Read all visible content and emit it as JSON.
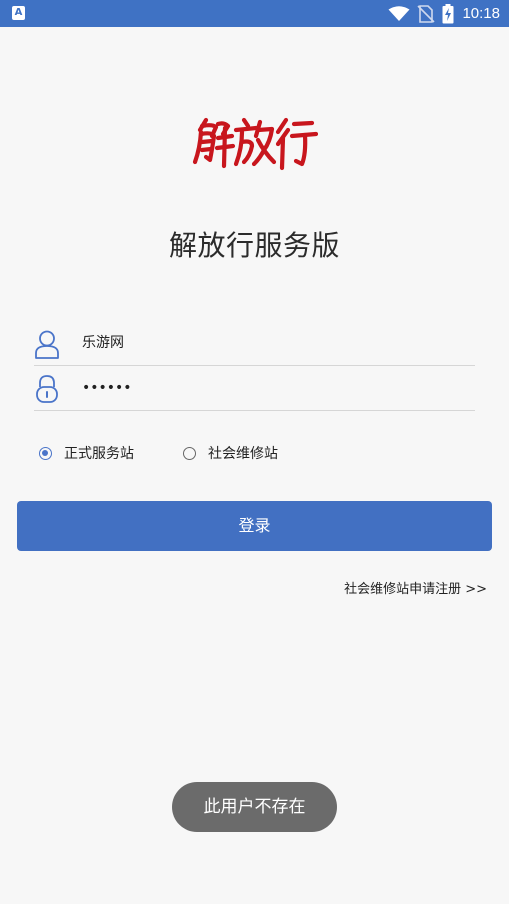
{
  "status_bar": {
    "left_icon": "A",
    "time": "10:18",
    "icons": [
      "wifi-icon",
      "no-sim-icon",
      "battery-charging-icon"
    ]
  },
  "app": {
    "logo_text": "解放行",
    "title": "解放行服务版"
  },
  "form": {
    "username": {
      "value": "乐游网",
      "icon": "user-icon"
    },
    "password": {
      "value": "••••••",
      "icon": "lock-icon"
    },
    "station_type": {
      "options": [
        {
          "label": "正式服务站",
          "checked": true
        },
        {
          "label": "社会维修站",
          "checked": false
        }
      ]
    },
    "login_button": "登录",
    "register_link": "社会维修站申请注册 >>"
  },
  "toast": {
    "message": "此用户不存在"
  },
  "colors": {
    "primary": "#4270c2",
    "status_bar": "#3f72c4",
    "logo_red": "#c8161d",
    "background": "#f7f7f7",
    "toast_bg": "#6b6b6b"
  }
}
